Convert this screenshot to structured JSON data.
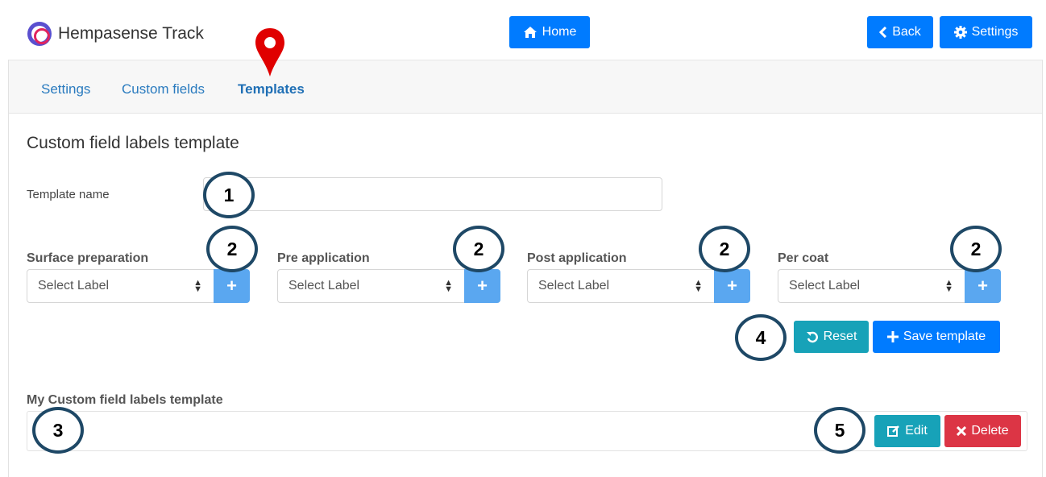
{
  "app": {
    "title": "Hempasense Track"
  },
  "header": {
    "home_label": "Home",
    "back_label": "Back",
    "settings_label": "Settings"
  },
  "tabs": [
    {
      "label": "Settings"
    },
    {
      "label": "Custom fields"
    },
    {
      "label": "Templates",
      "active": true
    }
  ],
  "form": {
    "section_title": "Custom field labels template",
    "template_name_label": "Template name",
    "template_name_value": "",
    "groups": [
      {
        "label": "Surface preparation",
        "selected": "Select Label"
      },
      {
        "label": "Pre application",
        "selected": "Select Label"
      },
      {
        "label": "Post application",
        "selected": "Select Label"
      },
      {
        "label": "Per coat",
        "selected": "Select Label"
      }
    ],
    "plus_label": "+",
    "reset_label": "Reset",
    "save_label": "Save template"
  },
  "my_templates": {
    "title": "My Custom field labels template",
    "edit_label": "Edit",
    "delete_label": "Delete"
  },
  "callouts": [
    "1",
    "2",
    "2",
    "2",
    "2",
    "3",
    "4",
    "5"
  ],
  "colors": {
    "primary": "#007bff",
    "info": "#17a2b8",
    "danger": "#dc3545",
    "light_blue": "#5aa7f0",
    "callout_border": "#1e4866",
    "pin": "#e00000"
  },
  "icons": {
    "brand": "brand-logo-icon",
    "home": "home-icon",
    "back": "chevron-left-icon",
    "settings": "gear-icon",
    "reset": "undo-icon",
    "save": "plus-icon",
    "edit": "edit-icon",
    "delete": "times-icon",
    "pin": "location-pin-icon"
  }
}
